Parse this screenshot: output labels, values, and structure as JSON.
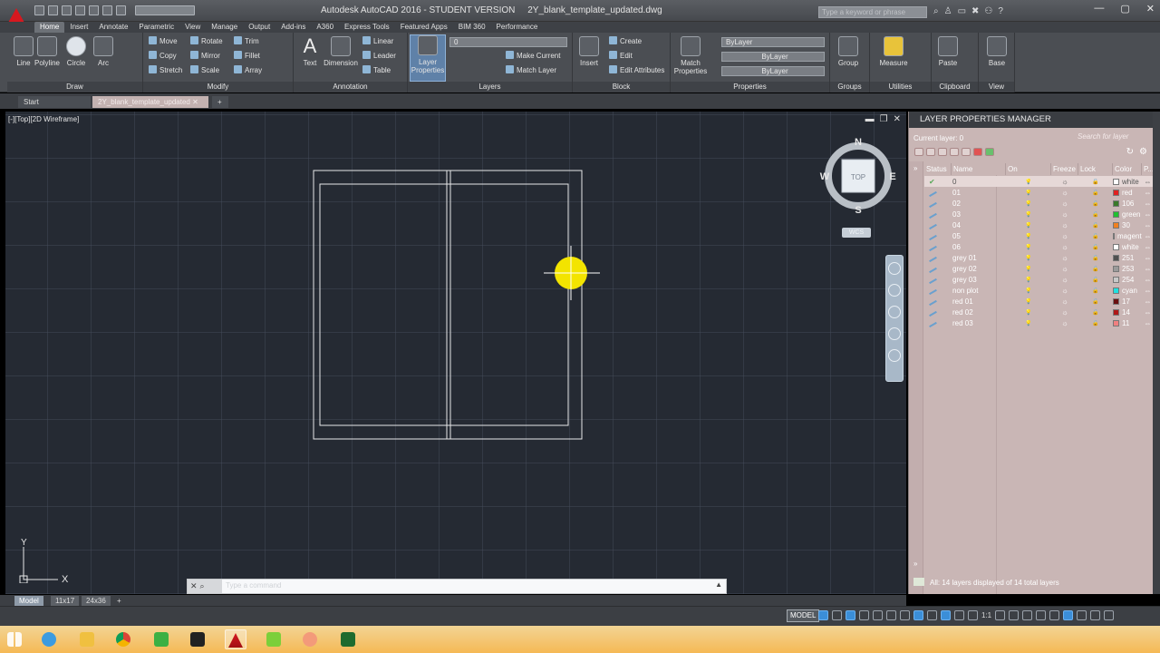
{
  "window": {
    "title": "Autodesk AutoCAD 2016 - STUDENT VERSION     2Y_blank_template_updated.dwg",
    "search_placeholder": "Type a keyword or phrase"
  },
  "ribbon_tabs": [
    "Home",
    "Insert",
    "Annotate",
    "Parametric",
    "View",
    "Manage",
    "Output",
    "Add-ins",
    "A360",
    "Express Tools",
    "Featured Apps",
    "BIM 360",
    "Performance"
  ],
  "draw": {
    "title": "Draw",
    "line": "Line",
    "polyline": "Polyline",
    "circle": "Circle",
    "arc": "Arc"
  },
  "modify": {
    "title": "Modify",
    "move": "Move",
    "rotate": "Rotate",
    "trim": "Trim",
    "copy": "Copy",
    "mirror": "Mirror",
    "fillet": "Fillet",
    "stretch": "Stretch",
    "scale": "Scale",
    "array": "Array"
  },
  "annotation": {
    "title": "Annotation",
    "text": "Text",
    "dimension": "Dimension",
    "linear": "Linear",
    "leader": "Leader",
    "table": "Table"
  },
  "layers": {
    "title": "Layers",
    "layer_properties": "Layer Properties",
    "current_combo": "0",
    "make_current": "Make Current",
    "match_layer": "Match Layer"
  },
  "block": {
    "title": "Block",
    "insert": "Insert",
    "create": "Create",
    "edit": "Edit",
    "edit_attributes": "Edit Attributes"
  },
  "properties": {
    "title": "Properties",
    "match_properties": "Match Properties",
    "color": "ByLayer",
    "linetype": "ByLayer",
    "lineweight": "ByLayer"
  },
  "groups": {
    "title": "Groups",
    "group": "Group"
  },
  "utilities": {
    "title": "Utilities",
    "measure": "Measure"
  },
  "clipboard": {
    "title": "Clipboard",
    "paste": "Paste"
  },
  "view": {
    "title": "View",
    "base": "Base"
  },
  "doc_tabs": {
    "start": "Start",
    "drawing": "2Y_blank_template_updated"
  },
  "viewport": {
    "label": "[-][Top][2D Wireframe]"
  },
  "viewcube": {
    "north": "N",
    "south": "S",
    "east": "E",
    "west": "W",
    "face": "TOP",
    "wcs": "WCS"
  },
  "ucs": {
    "y": "Y",
    "x": "X"
  },
  "command_line": {
    "placeholder": "Type a command"
  },
  "layout_tabs": [
    "Model",
    "11x17",
    "24x36"
  ],
  "layer_panel": {
    "title": "LAYER PROPERTIES MANAGER",
    "current_layer": "Current layer: 0",
    "search_placeholder": "Search for layer",
    "columns": [
      "Status",
      "Name",
      "On",
      "Freeze",
      "Lock",
      "Color",
      "P..."
    ],
    "status_text": "All: 14 layers displayed of 14 total layers",
    "rows": [
      {
        "name": "0",
        "color": "white",
        "swatch": "#ffffff"
      },
      {
        "name": "01",
        "color": "red",
        "swatch": "#e02020"
      },
      {
        "name": "02",
        "color": "106",
        "swatch": "#3a7a2a"
      },
      {
        "name": "03",
        "color": "green",
        "swatch": "#20c030"
      },
      {
        "name": "04",
        "color": "30",
        "swatch": "#f08020"
      },
      {
        "name": "05",
        "color": "magenta",
        "swatch": "#e020e0"
      },
      {
        "name": "06",
        "color": "white",
        "swatch": "#ffffff"
      },
      {
        "name": "grey 01",
        "color": "251",
        "swatch": "#505050"
      },
      {
        "name": "grey 02",
        "color": "253",
        "swatch": "#9a9a9a"
      },
      {
        "name": "grey 03",
        "color": "254",
        "swatch": "#c8c8c8"
      },
      {
        "name": "non plot",
        "color": "cyan",
        "swatch": "#20e0e0"
      },
      {
        "name": "red 01",
        "color": "17",
        "swatch": "#6a1010"
      },
      {
        "name": "red 02",
        "color": "14",
        "swatch": "#b01818"
      },
      {
        "name": "red 03",
        "color": "11",
        "swatch": "#f08080"
      }
    ]
  },
  "statusbar": {
    "model": "MODEL",
    "scale": "1:1"
  },
  "colors": {
    "canvas": "#252a33",
    "panel": "#c9b6b5",
    "cursor": "#f3e400"
  }
}
